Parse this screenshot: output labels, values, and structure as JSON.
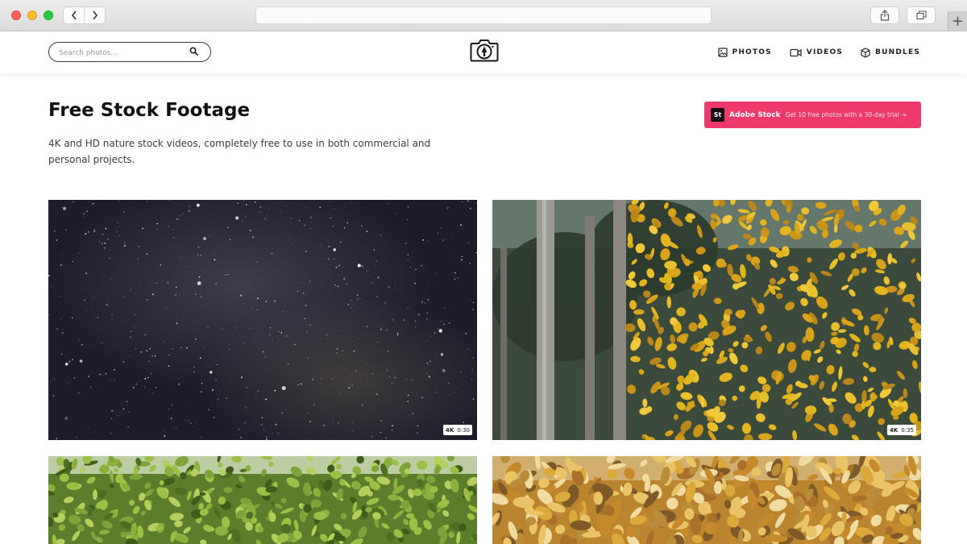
{
  "browser": {
    "back_glyph": "‹",
    "forward_glyph": "›",
    "new_tab_glyph": "+"
  },
  "header": {
    "search": {
      "placeholder": "Search photos..."
    },
    "icons": {
      "search": "search-icon",
      "logo": "camera-logo-icon"
    },
    "nav": [
      {
        "label": "PHOTOS",
        "icon": "image-icon"
      },
      {
        "label": "VIDEOS",
        "icon": "video-camera-icon"
      },
      {
        "label": "BUNDLES",
        "icon": "box-icon"
      }
    ]
  },
  "page": {
    "title": "Free Stock Footage",
    "description": "4K and HD nature stock videos, completely free to use in both commercial and personal projects."
  },
  "promo": {
    "badge": "St",
    "brand": "Adobe Stock",
    "text": "Get 10 free photos with a 30-day trial →",
    "color": "#ee3a6a"
  },
  "videos": [
    {
      "subject": "starry night sky",
      "resolution": "4K",
      "duration": "0:30"
    },
    {
      "subject": "yellow autumn tree in forest",
      "resolution": "4K",
      "duration": "0:35"
    },
    {
      "subject": "green tree canopy"
    },
    {
      "subject": "fallen autumn leaves"
    }
  ]
}
